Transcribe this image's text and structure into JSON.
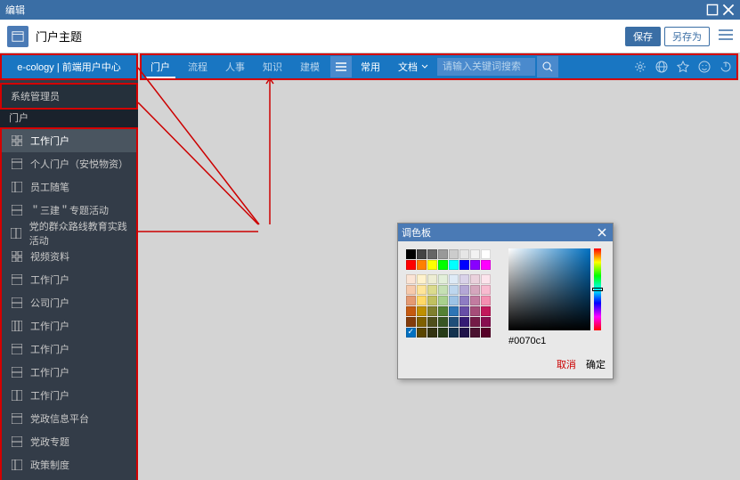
{
  "window": {
    "title": "编辑"
  },
  "header": {
    "subtitle": "门户主题",
    "save": "保存",
    "save_as": "另存为"
  },
  "brand": "e-cology | 前端用户中心",
  "admin": "系统管理员",
  "category": "门户",
  "sidebar": {
    "items": [
      {
        "label": "工作门户"
      },
      {
        "label": "个人门户（安悦物资）"
      },
      {
        "label": "员工随笔"
      },
      {
        "label": "＂三建＂专题活动"
      },
      {
        "label": "党的群众路线教育实践活动"
      },
      {
        "label": "视频资料"
      },
      {
        "label": "工作门户"
      },
      {
        "label": "公司门户"
      },
      {
        "label": "工作门户"
      },
      {
        "label": "工作门户"
      },
      {
        "label": "工作门户"
      },
      {
        "label": "工作门户"
      },
      {
        "label": "党政信息平台"
      },
      {
        "label": "党政专题"
      },
      {
        "label": "政策制度"
      }
    ]
  },
  "topbar": {
    "tabs": [
      {
        "label": "门户"
      },
      {
        "label": "流程"
      },
      {
        "label": "人事"
      },
      {
        "label": "知识"
      },
      {
        "label": "建模"
      }
    ],
    "common": "常用",
    "doc_dropdown": "文档",
    "search_placeholder": "请输入关键词搜索"
  },
  "palette": {
    "title": "调色板",
    "hex": "#0070c1",
    "cancel": "取消",
    "ok": "确定"
  }
}
